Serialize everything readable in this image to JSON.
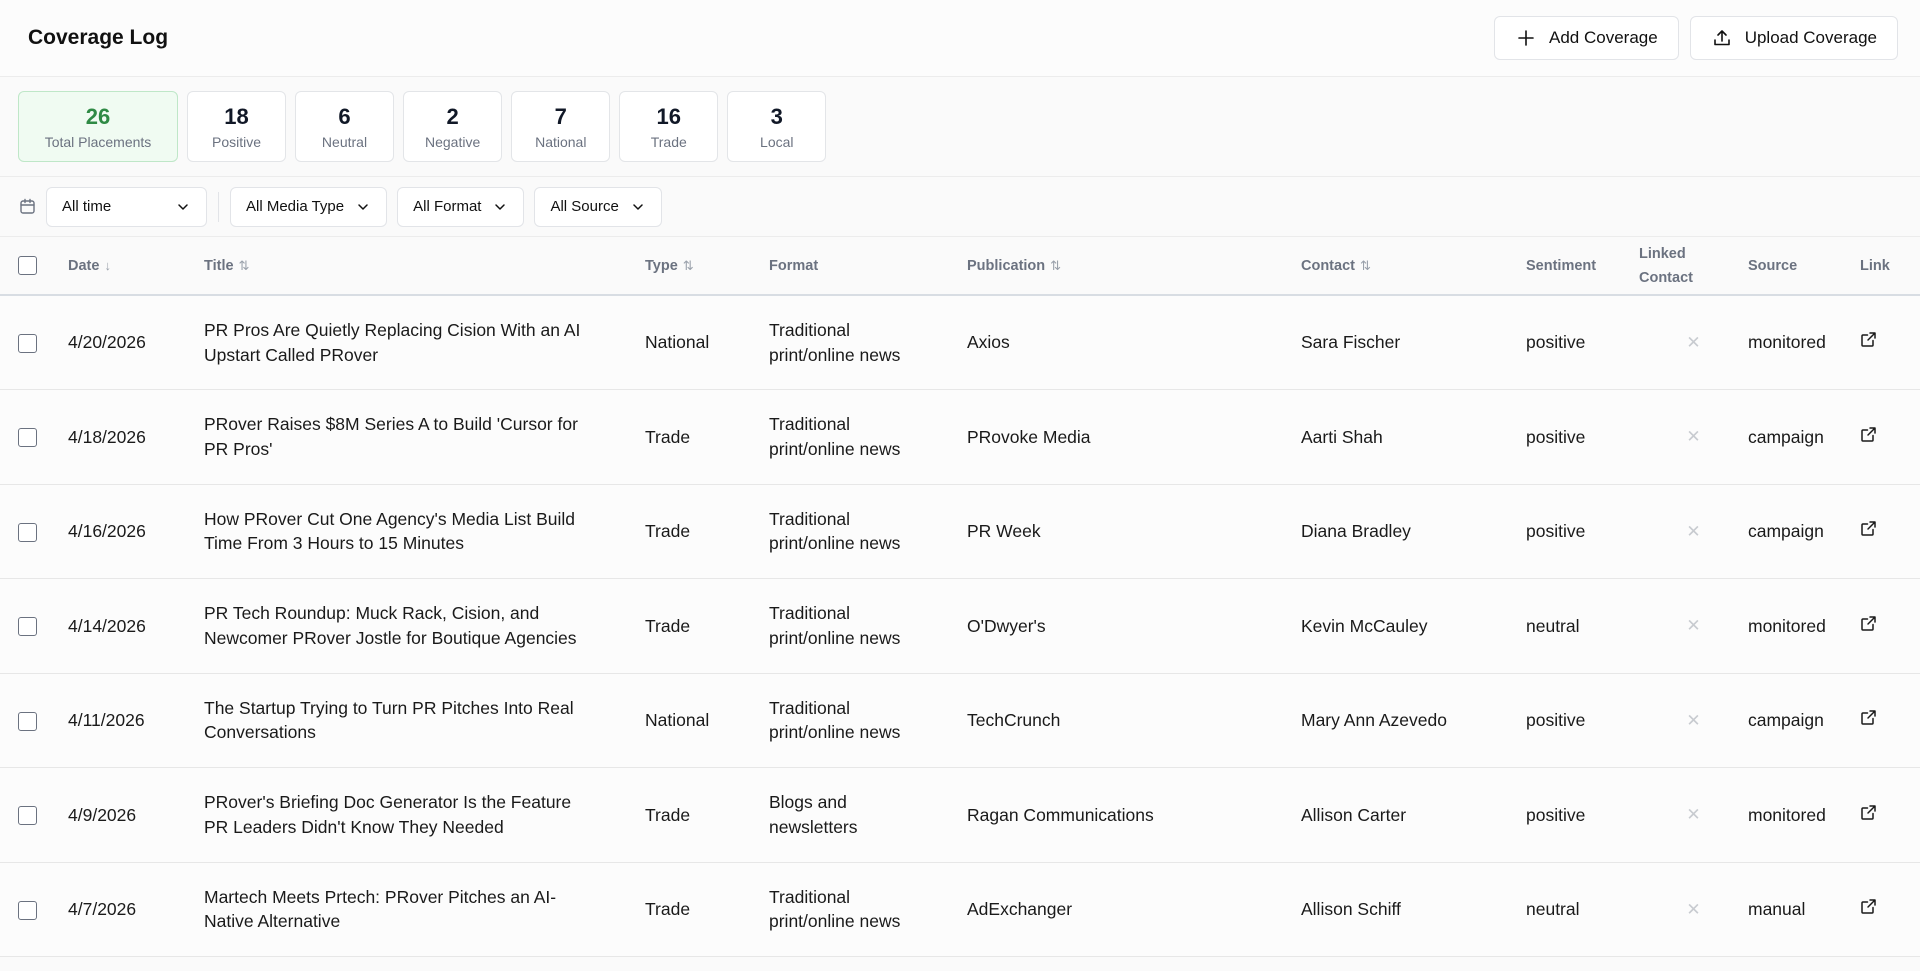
{
  "header": {
    "title": "Coverage Log",
    "add_label": "Add Coverage",
    "upload_label": "Upload Coverage"
  },
  "stats": [
    {
      "value": "26",
      "label": "Total Placements",
      "active": true
    },
    {
      "value": "18",
      "label": "Positive"
    },
    {
      "value": "6",
      "label": "Neutral"
    },
    {
      "value": "2",
      "label": "Negative"
    },
    {
      "value": "7",
      "label": "National"
    },
    {
      "value": "16",
      "label": "Trade"
    },
    {
      "value": "3",
      "label": "Local"
    }
  ],
  "filters": {
    "time": "All time",
    "media_type": "All Media Type",
    "format": "All Format",
    "source": "All Source"
  },
  "table": {
    "columns": {
      "date": "Date",
      "title": "Title",
      "type": "Type",
      "format": "Format",
      "publication": "Publication",
      "contact": "Contact",
      "sentiment": "Sentiment",
      "linked_contact_1": "Linked",
      "linked_contact_2": "Contact",
      "source": "Source",
      "link": "Link"
    },
    "rows": [
      {
        "date": "4/20/2026",
        "title_1": "PR Pros Are Quietly Replacing Cision With an AI",
        "title_2": "Upstart Called PRover",
        "type": "National",
        "format_1": "Traditional",
        "format_2": "print/online news",
        "publication": "Axios",
        "contact": "Sara Fischer",
        "sentiment": "positive",
        "source": "monitored"
      },
      {
        "date": "4/18/2026",
        "title_1": "PRover Raises $8M Series A to Build 'Cursor for",
        "title_2": "PR Pros'",
        "type": "Trade",
        "format_1": "Traditional",
        "format_2": "print/online news",
        "publication": "PRovoke Media",
        "contact": "Aarti Shah",
        "sentiment": "positive",
        "source": "campaign"
      },
      {
        "date": "4/16/2026",
        "title_1": "How PRover Cut One Agency's Media List Build",
        "title_2": "Time From 3 Hours to 15 Minutes",
        "type": "Trade",
        "format_1": "Traditional",
        "format_2": "print/online news",
        "publication": "PR Week",
        "contact": "Diana Bradley",
        "sentiment": "positive",
        "source": "campaign"
      },
      {
        "date": "4/14/2026",
        "title_1": "PR Tech Roundup: Muck Rack, Cision, and",
        "title_2": "Newcomer PRover Jostle for Boutique Agencies",
        "type": "Trade",
        "format_1": "Traditional",
        "format_2": "print/online news",
        "publication": "O'Dwyer's",
        "contact": "Kevin McCauley",
        "sentiment": "neutral",
        "source": "monitored"
      },
      {
        "date": "4/11/2026",
        "title_1": "The Startup Trying to Turn PR Pitches Into Real",
        "title_2": "Conversations",
        "type": "National",
        "format_1": "Traditional",
        "format_2": "print/online news",
        "publication": "TechCrunch",
        "contact": "Mary Ann Azevedo",
        "sentiment": "positive",
        "source": "campaign"
      },
      {
        "date": "4/9/2026",
        "title_1": "PRover's Briefing Doc Generator Is the Feature",
        "title_2": "PR Leaders Didn't Know They Needed",
        "type": "Trade",
        "format_1": "Blogs and",
        "format_2": "newsletters",
        "publication": "Ragan Communications",
        "contact": "Allison Carter",
        "sentiment": "positive",
        "source": "monitored"
      },
      {
        "date": "4/7/2026",
        "title_1": "Martech Meets Prtech: PRover Pitches an AI-",
        "title_2": "Native Alternative",
        "type": "Trade",
        "format_1": "Traditional",
        "format_2": "print/online news",
        "publication": "AdExchanger",
        "contact": "Allison Schiff",
        "sentiment": "neutral",
        "source": "manual"
      }
    ]
  },
  "icons": {
    "add": "plus-icon",
    "upload": "upload-icon",
    "calendar": "calendar-icon",
    "chevron": "chevron-down-icon",
    "sort": "sort-icon",
    "unlinked": "x-icon",
    "external": "external-link-icon"
  },
  "colors": {
    "accent_green": "#2f8a45",
    "active_bg": "#f0fbf2"
  }
}
